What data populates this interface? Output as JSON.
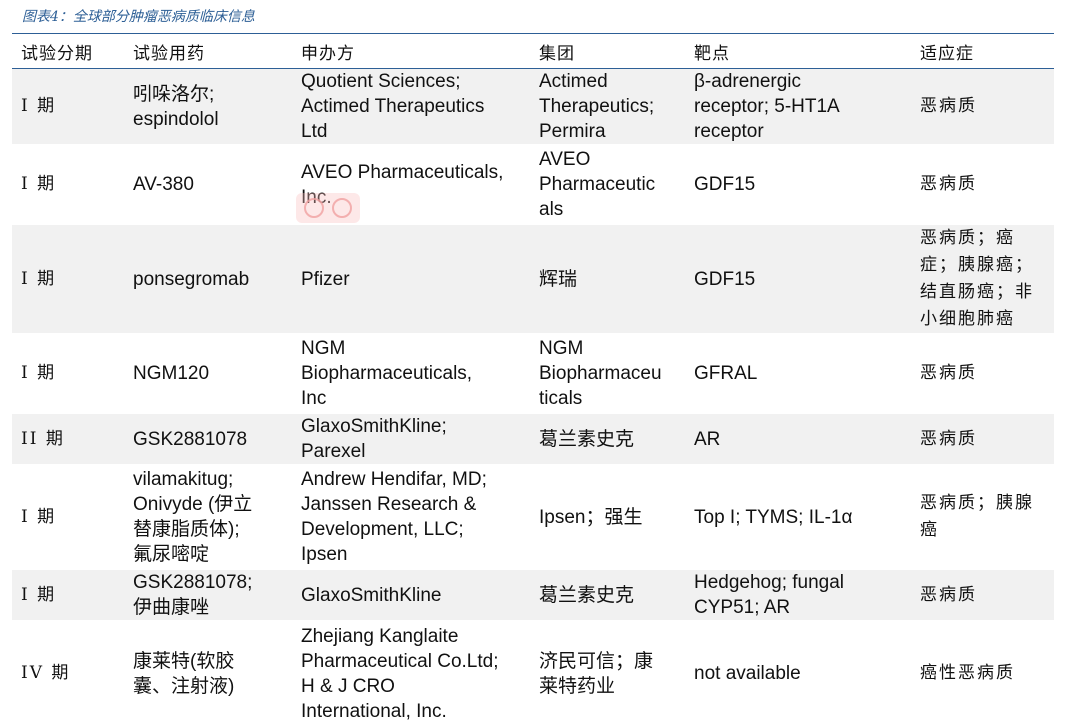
{
  "caption": "图表4：全球部分肿瘤恶病质临床信息",
  "table": {
    "headers": [
      "试验分期",
      "试验用药",
      "申办方",
      "集团",
      "靶点",
      "适应症"
    ],
    "rows": [
      [
        "I 期",
        "吲哚洛尔;\nespindolol",
        "Quotient Sciences;\nActimed Therapeutics\nLtd",
        "Actimed\nTherapeutics;\nPermira",
        "β-adrenergic\nreceptor; 5-HT1A\nreceptor",
        "恶病质"
      ],
      [
        "I 期",
        "AV-380",
        "AVEO Pharmaceuticals,\nInc.",
        "AVEO\nPharmaceutic\nals",
        "GDF15",
        "恶病质"
      ],
      [
        "I 期",
        "ponsegromab",
        "Pfizer",
        "辉瑞",
        "GDF15",
        "恶病质；癌\n症；胰腺癌；\n结直肠癌；非\n小细胞肺癌"
      ],
      [
        "I 期",
        "NGM120",
        "NGM\nBiopharmaceuticals,\nInc",
        "NGM\nBiopharmaceu\nticals",
        "GFRAL",
        "恶病质"
      ],
      [
        "II 期",
        "GSK2881078",
        "GlaxoSmithKline;\nParexel",
        "葛兰素史克",
        "AR",
        "恶病质"
      ],
      [
        "I 期",
        "vilamakitug;\nOnivyde (伊立\n替康脂质体);\n氟尿嘧啶",
        "Andrew Hendifar, MD;\nJanssen Research &\nDevelopment, LLC;\nIpsen",
        "Ipsen；强生",
        "Top I; TYMS; IL-1α",
        "恶病质；胰腺\n癌"
      ],
      [
        "I 期",
        "GSK2881078;\n伊曲康唑",
        "GlaxoSmithKline",
        "葛兰素史克",
        "Hedgehog; fungal\nCYP51; AR",
        "恶病质"
      ],
      [
        "IV 期",
        "康莱特(软胶\n囊、注射液)",
        "Zhejiang Kanglaite\nPharmaceutical Co.Ltd;\nH & J CRO\nInternational, Inc.",
        "济民可信；康\n莱特药业",
        "not available",
        "癌性恶病质"
      ]
    ]
  }
}
